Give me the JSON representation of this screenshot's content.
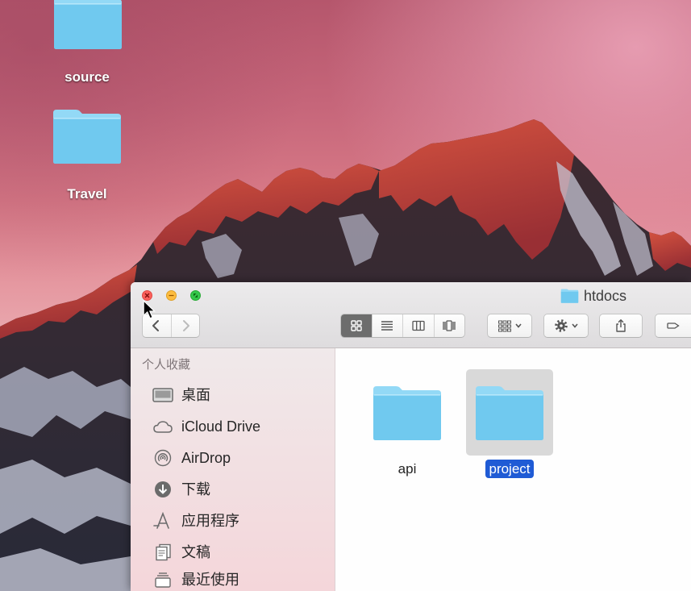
{
  "desktop": {
    "icons": [
      {
        "label": "source",
        "icon": "folder-icon"
      },
      {
        "label": "Travel",
        "icon": "folder-icon"
      }
    ]
  },
  "finder": {
    "title": "htdocs",
    "title_icon": "folder-icon",
    "traffic_lights": [
      "close-icon",
      "minimize-icon",
      "fullscreen-icon"
    ],
    "toolbar": {
      "navigation": [
        "back-icon",
        "forward-icon"
      ],
      "views": [
        {
          "icon": "icon-view-icon",
          "active": true
        },
        {
          "icon": "list-view-icon",
          "active": false
        },
        {
          "icon": "column-view-icon",
          "active": false
        },
        {
          "icon": "cover-flow-icon",
          "active": false
        }
      ],
      "buttons": [
        "arrange-icon",
        "gear-icon",
        "share-icon",
        "tag-icon"
      ]
    },
    "sidebar": {
      "section_title": "个人收藏",
      "items": [
        {
          "label": "桌面",
          "icon": "desktop-icon"
        },
        {
          "label": "iCloud Drive",
          "icon": "icloud-icon"
        },
        {
          "label": "AirDrop",
          "icon": "airdrop-icon"
        },
        {
          "label": "下载",
          "icon": "downloads-icon"
        },
        {
          "label": "应用程序",
          "icon": "applications-icon"
        },
        {
          "label": "文稿",
          "icon": "documents-icon"
        },
        {
          "label": "最近使用",
          "icon": "recents-icon"
        }
      ]
    },
    "files": [
      {
        "name": "api",
        "icon": "folder-icon",
        "selected": false
      },
      {
        "name": "project",
        "icon": "folder-icon",
        "selected": true
      }
    ]
  },
  "colors": {
    "close": "#fc605c",
    "minimize": "#fdbc40",
    "zoom": "#34c84a",
    "folder": "#70c9ef",
    "selection": "#1f5bd5",
    "selection_bg": "#d9d9d9"
  }
}
